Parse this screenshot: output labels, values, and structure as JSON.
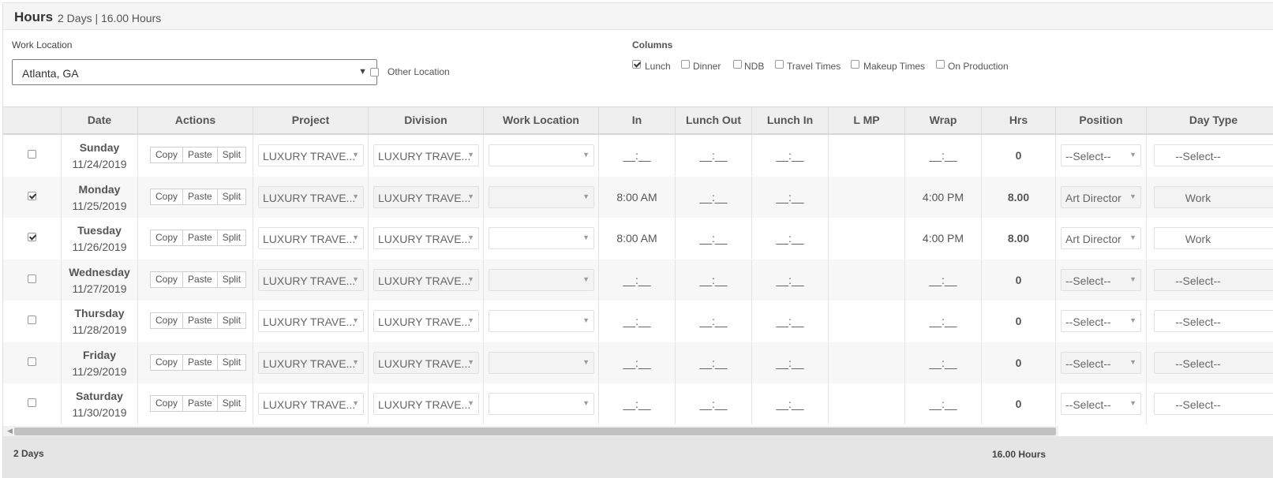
{
  "header": {
    "title": "Hours",
    "summary": "2 Days | 16.00 Hours"
  },
  "work_location": {
    "label": "Work Location",
    "value": "Atlanta, GA",
    "other_label": "Other Location",
    "other_checked": false
  },
  "columns_panel": {
    "label": "Columns",
    "options": [
      {
        "label": "Lunch",
        "checked": true
      },
      {
        "label": "Dinner",
        "checked": false
      },
      {
        "label": "NDB",
        "checked": false
      },
      {
        "label": "Travel Times",
        "checked": false
      },
      {
        "label": "Makeup Times",
        "checked": false
      },
      {
        "label": "On Production",
        "checked": false
      }
    ]
  },
  "table": {
    "headers": [
      "",
      "Date",
      "Actions",
      "Project",
      "Division",
      "Work Location",
      "In",
      "Lunch Out",
      "Lunch In",
      "L MP",
      "Wrap",
      "Hrs",
      "Position",
      "Day Type"
    ],
    "buttons": {
      "copy": "Copy",
      "paste": "Paste",
      "split": "Split"
    },
    "rows": [
      {
        "checked": false,
        "day": "Sunday",
        "date": "11/24/2019",
        "project": "LUXURY TRAVE...",
        "division": "LUXURY TRAVE...",
        "work_location": "",
        "in": "__:__",
        "lunch_out": "__:__",
        "lunch_in": "__:__",
        "lmp": "",
        "wrap": "__:__",
        "hrs": "0",
        "position": "--Select--",
        "day_type": "--Select--"
      },
      {
        "checked": true,
        "day": "Monday",
        "date": "11/25/2019",
        "project": "LUXURY TRAVE...",
        "division": "LUXURY TRAVE...",
        "work_location": "",
        "in": "8:00 AM",
        "lunch_out": "__:__",
        "lunch_in": "__:__",
        "lmp": "",
        "wrap": "4:00 PM",
        "hrs": "8.00",
        "position": "Art Director",
        "day_type": "Work"
      },
      {
        "checked": true,
        "day": "Tuesday",
        "date": "11/26/2019",
        "project": "LUXURY TRAVE...",
        "division": "LUXURY TRAVE...",
        "work_location": "",
        "in": "8:00 AM",
        "lunch_out": "__:__",
        "lunch_in": "__:__",
        "lmp": "",
        "wrap": "4:00 PM",
        "hrs": "8.00",
        "position": "Art Director",
        "day_type": "Work"
      },
      {
        "checked": false,
        "day": "Wednesday",
        "date": "11/27/2019",
        "project": "LUXURY TRAVE...",
        "division": "LUXURY TRAVE...",
        "work_location": "",
        "in": "__:__",
        "lunch_out": "__:__",
        "lunch_in": "__:__",
        "lmp": "",
        "wrap": "__:__",
        "hrs": "0",
        "position": "--Select--",
        "day_type": "--Select--"
      },
      {
        "checked": false,
        "day": "Thursday",
        "date": "11/28/2019",
        "project": "LUXURY TRAVE...",
        "division": "LUXURY TRAVE...",
        "work_location": "",
        "in": "__:__",
        "lunch_out": "__:__",
        "lunch_in": "__:__",
        "lmp": "",
        "wrap": "__:__",
        "hrs": "0",
        "position": "--Select--",
        "day_type": "--Select--"
      },
      {
        "checked": false,
        "day": "Friday",
        "date": "11/29/2019",
        "project": "LUXURY TRAVE...",
        "division": "LUXURY TRAVE...",
        "work_location": "",
        "in": "__:__",
        "lunch_out": "__:__",
        "lunch_in": "__:__",
        "lmp": "",
        "wrap": "__:__",
        "hrs": "0",
        "position": "--Select--",
        "day_type": "--Select--"
      },
      {
        "checked": false,
        "day": "Saturday",
        "date": "11/30/2019",
        "project": "LUXURY TRAVE...",
        "division": "LUXURY TRAVE...",
        "work_location": "",
        "in": "__:__",
        "lunch_out": "__:__",
        "lunch_in": "__:__",
        "lmp": "",
        "wrap": "__:__",
        "hrs": "0",
        "position": "--Select--",
        "day_type": "--Select--"
      }
    ]
  },
  "footer": {
    "days": "2 Days",
    "hours": "16.00 Hours"
  },
  "colors": {
    "accent": "#3d93c5",
    "header_bg": "#efefef",
    "footer_bg": "#e5e5e5"
  }
}
